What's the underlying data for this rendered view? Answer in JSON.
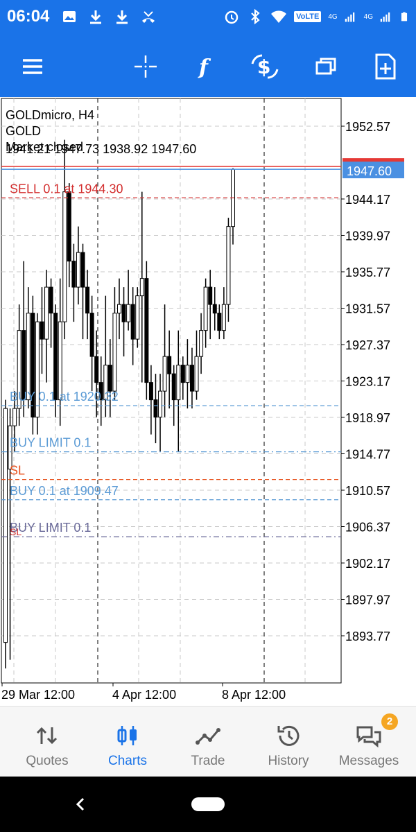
{
  "status_bar": {
    "time": "06:04",
    "left_icons": [
      "image-icon",
      "download-icon",
      "download-icon",
      "missed-call-icon"
    ],
    "right_icons": [
      "alarm-icon",
      "bluetooth-icon",
      "wifi-icon",
      "volte-badge",
      "signal-4g-icon",
      "signal-4g-icon",
      "battery-icon"
    ],
    "volte_label": "VoLTE",
    "net1": "4G",
    "net2": "4G"
  },
  "toolbar": {
    "buttons": [
      "menu-icon",
      "crosshair-icon",
      "indicators-icon",
      "new-order-icon",
      "windows-icon",
      "add-chart-icon"
    ]
  },
  "chart": {
    "symbol_line": "GOLDmicro, H4",
    "description": "GOLD",
    "market_status": "Market closed",
    "ohlc": "1941.21 1947.73 1938.92 1947.60",
    "current_price": "1947.60",
    "y_ticks": [
      "1952.57",
      "1944.17",
      "1939.97",
      "1935.77",
      "1931.57",
      "1927.37",
      "1923.17",
      "1918.97",
      "1914.77",
      "1910.57",
      "1906.37",
      "1902.17",
      "1897.97",
      "1893.77"
    ],
    "x_ticks": [
      "29 Mar 12:00",
      "4 Apr 12:00",
      "8 Apr 12:00"
    ],
    "orders": [
      {
        "label": "SELL 0.1 at 1944.30",
        "type": "sell",
        "price": 1944.3
      },
      {
        "label": "BUY 0.1 at 1920.32",
        "type": "buy",
        "price": 1920.32
      },
      {
        "label": "BUY LIMIT 0.1",
        "type": "buy-limit",
        "price": 1915.0
      },
      {
        "label": "SL",
        "type": "sl",
        "price": 1911.8
      },
      {
        "label": "BUY 0.1 at 1909.47",
        "type": "buy",
        "price": 1909.47
      },
      {
        "label": "BUY LIMIT 0.1",
        "type": "buy-limit-dark",
        "price": 1905.2
      },
      {
        "label": "SL",
        "type": "sl-small",
        "price": 1905.2
      }
    ],
    "colors": {
      "sell": "#d32f2f",
      "buy": "#5b9bd5",
      "sl": "#e8531f",
      "buy_limit_dark": "#6b6b9a",
      "bid_line": "#4a90e2",
      "ask_line": "#e53935"
    }
  },
  "chart_data": {
    "type": "candlestick",
    "title": "GOLDmicro, H4",
    "ylim": [
      1891,
      1958
    ],
    "x_labels": [
      "29 Mar 12:00",
      "4 Apr 12:00",
      "8 Apr 12:00"
    ],
    "candles": [
      [
        1893,
        1920,
        1890,
        1921
      ],
      [
        1913,
        1918,
        1891,
        1920
      ],
      [
        1918,
        1920,
        1915,
        1922
      ],
      [
        1920,
        1929,
        1918,
        1932
      ],
      [
        1929,
        1921,
        1919,
        1937
      ],
      [
        1921,
        1931,
        1920,
        1934
      ],
      [
        1931,
        1919,
        1917,
        1933
      ],
      [
        1919,
        1930,
        1917,
        1931
      ],
      [
        1930,
        1928,
        1924,
        1934
      ],
      [
        1928,
        1934,
        1923,
        1936
      ],
      [
        1934,
        1931,
        1927,
        1935
      ],
      [
        1931,
        1921,
        1919,
        1932
      ],
      [
        1921,
        1930,
        1918,
        1935
      ],
      [
        1930,
        1945,
        1928,
        1951
      ],
      [
        1945,
        1937,
        1934,
        1946
      ],
      [
        1937,
        1934,
        1930,
        1939
      ],
      [
        1934,
        1938,
        1932,
        1941
      ],
      [
        1938,
        1934,
        1928,
        1939
      ],
      [
        1934,
        1931,
        1928,
        1936
      ],
      [
        1931,
        1926,
        1922,
        1933
      ],
      [
        1926,
        1923,
        1919,
        1929
      ],
      [
        1923,
        1921,
        1918,
        1926
      ],
      [
        1921,
        1925,
        1919,
        1933
      ],
      [
        1925,
        1922,
        1919,
        1928
      ],
      [
        1922,
        1931,
        1921,
        1934
      ],
      [
        1931,
        1932,
        1928,
        1935
      ],
      [
        1932,
        1930,
        1926,
        1934
      ],
      [
        1930,
        1932,
        1929,
        1936
      ],
      [
        1932,
        1928,
        1925,
        1934
      ],
      [
        1928,
        1933,
        1927,
        1934
      ],
      [
        1933,
        1935,
        1923,
        1945
      ],
      [
        1935,
        1923,
        1921,
        1937
      ],
      [
        1923,
        1921,
        1917,
        1925
      ],
      [
        1921,
        1919,
        1916,
        1924
      ],
      [
        1919,
        1922,
        1915,
        1924
      ],
      [
        1922,
        1926,
        1919,
        1932
      ],
      [
        1926,
        1924,
        1920,
        1929
      ],
      [
        1924,
        1921,
        1918,
        1925
      ],
      [
        1921,
        1925,
        1915,
        1929
      ],
      [
        1925,
        1923,
        1921,
        1926
      ],
      [
        1923,
        1925,
        1920,
        1928
      ],
      [
        1925,
        1922,
        1920,
        1927
      ],
      [
        1922,
        1926,
        1921,
        1929
      ],
      [
        1926,
        1929,
        1924,
        1931
      ],
      [
        1929,
        1934,
        1927,
        1935
      ],
      [
        1934,
        1932,
        1928,
        1936
      ],
      [
        1932,
        1931,
        1929,
        1934
      ],
      [
        1931,
        1929,
        1928,
        1932
      ],
      [
        1929,
        1932,
        1928,
        1934
      ],
      [
        1932,
        1941,
        1930,
        1942
      ],
      [
        1941,
        1947.6,
        1938.92,
        1947.73
      ]
    ]
  },
  "bottom_nav": {
    "items": [
      {
        "label": "Quotes",
        "icon": "quotes-icon"
      },
      {
        "label": "Charts",
        "icon": "charts-icon",
        "active": true
      },
      {
        "label": "Trade",
        "icon": "trade-icon"
      },
      {
        "label": "History",
        "icon": "history-icon"
      },
      {
        "label": "Messages",
        "icon": "messages-icon",
        "badge": "2"
      }
    ]
  }
}
